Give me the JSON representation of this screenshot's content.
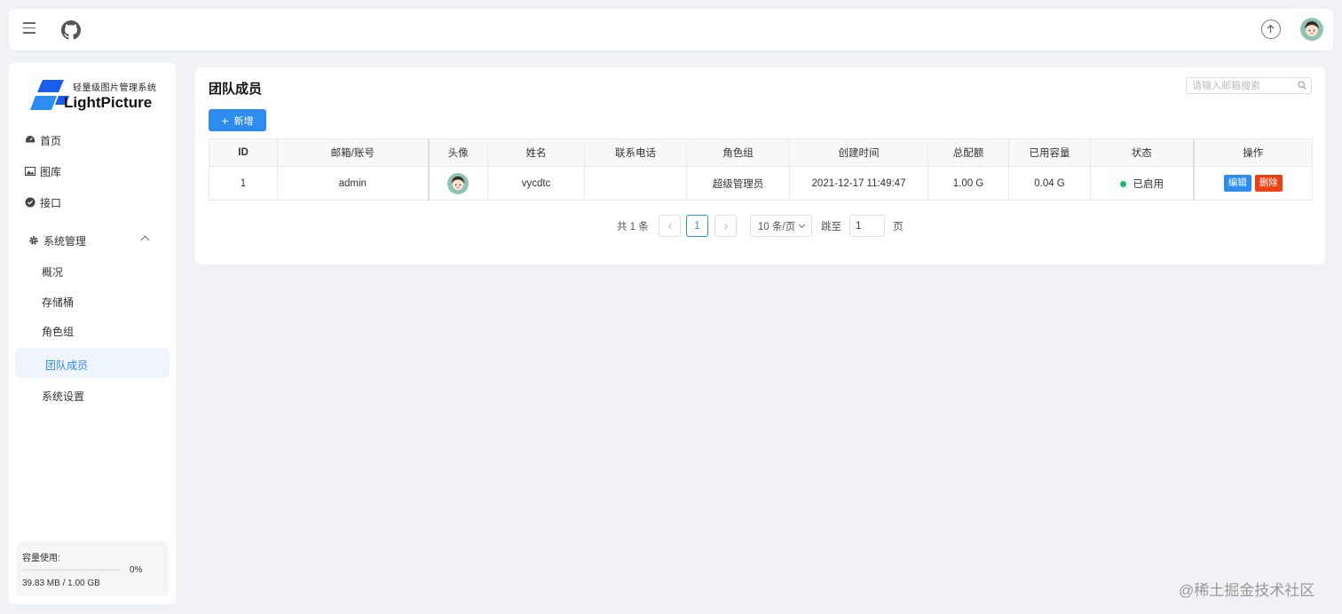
{
  "app": {
    "logo_sub": "轻量级图片管理系统",
    "logo_name": "LightPicture"
  },
  "header": {
    "menu_icon": "hamburger-icon",
    "github_icon": "github-icon",
    "upload_icon": "upload-icon",
    "avatar_icon": "avatar"
  },
  "sidebar": {
    "items": [
      {
        "label": "首页",
        "icon": "dashboard-icon"
      },
      {
        "label": "图库",
        "icon": "image-icon"
      },
      {
        "label": "接口",
        "icon": "api-icon"
      },
      {
        "label": "系统管理",
        "icon": "gear-icon"
      }
    ],
    "sub_items": [
      {
        "label": "概况"
      },
      {
        "label": "存储桶"
      },
      {
        "label": "角色组"
      },
      {
        "label": "团队成员"
      },
      {
        "label": "系统设置"
      }
    ],
    "usage": {
      "title": "容量使用:",
      "percent_label": "0%",
      "percent": 0.04,
      "detail": "39.83 MB / 1.00 GB"
    }
  },
  "main": {
    "title": "团队成员",
    "search_placeholder": "请输入邮箱搜索",
    "add_label": "新增",
    "columns": [
      "ID",
      "邮箱/账号",
      "头像",
      "姓名",
      "联系电话",
      "角色组",
      "创建时间",
      "总配额",
      "已用容量",
      "状态",
      "操作"
    ],
    "rows": [
      {
        "id": "1",
        "account": "admin",
        "name": "vycdtc",
        "phone": "",
        "role": "超级管理员",
        "created": "2021-12-17 11:49:47",
        "quota": "1.00 G",
        "used": "0.04 G",
        "status": "已启用",
        "edit_label": "编辑",
        "delete_label": "删除"
      }
    ],
    "pager": {
      "total": "共 1 条",
      "current": "1",
      "page_size": "10 条/页",
      "jump_label": "跳至",
      "jump_value": "1",
      "page_label": "页"
    }
  },
  "colors": {
    "primary": "#2d8cf0",
    "danger": "#ed4014",
    "success": "#19be6b"
  },
  "watermark": "@稀土掘金技术社区"
}
